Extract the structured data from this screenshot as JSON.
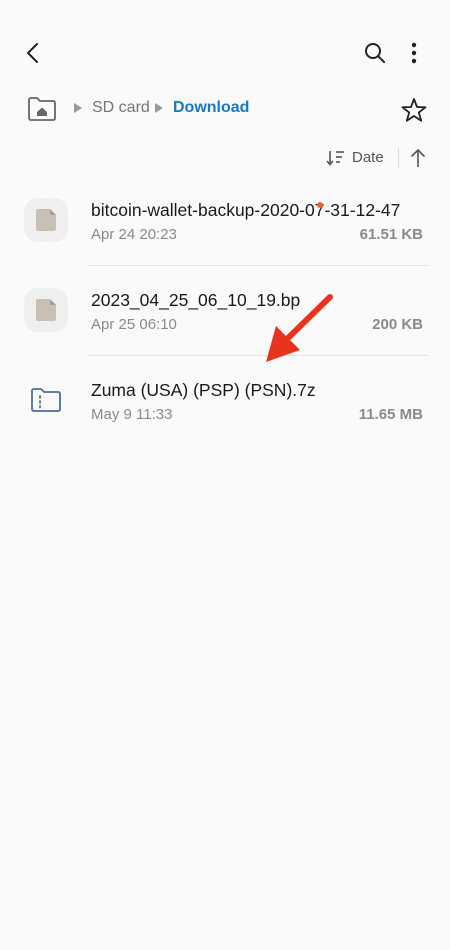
{
  "topbar": {
    "back_icon": "back-arrow-icon",
    "search_icon": "search-icon",
    "more_icon": "more-vertical-icon"
  },
  "breadcrumb": {
    "home_icon": "home-folder-icon",
    "items": [
      "SD card",
      "Download"
    ],
    "favorite_icon": "star-icon"
  },
  "sort": {
    "label": "Date",
    "order_icon": "sort-order-icon",
    "direction_icon": "arrow-up-icon"
  },
  "files": [
    {
      "name": "bitcoin-wallet-backup-2020-07-31-12-47",
      "date": "Apr 24 20:23",
      "size": "61.51 KB",
      "icon": "file-icon"
    },
    {
      "name": "2023_04_25_06_10_19.bp",
      "date": "Apr 25 06:10",
      "size": "200 KB",
      "icon": "file-icon"
    },
    {
      "name": "Zuma (USA) (PSP) (PSN).7z",
      "date": "May 9 11:33",
      "size": "11.65 MB",
      "icon": "archive-folder-icon",
      "is_new": true
    }
  ],
  "colors": {
    "accent": "#1a78c2",
    "new_dot": "#e8642c",
    "annotation_arrow": "#e8341c",
    "background": "#fafafa"
  }
}
